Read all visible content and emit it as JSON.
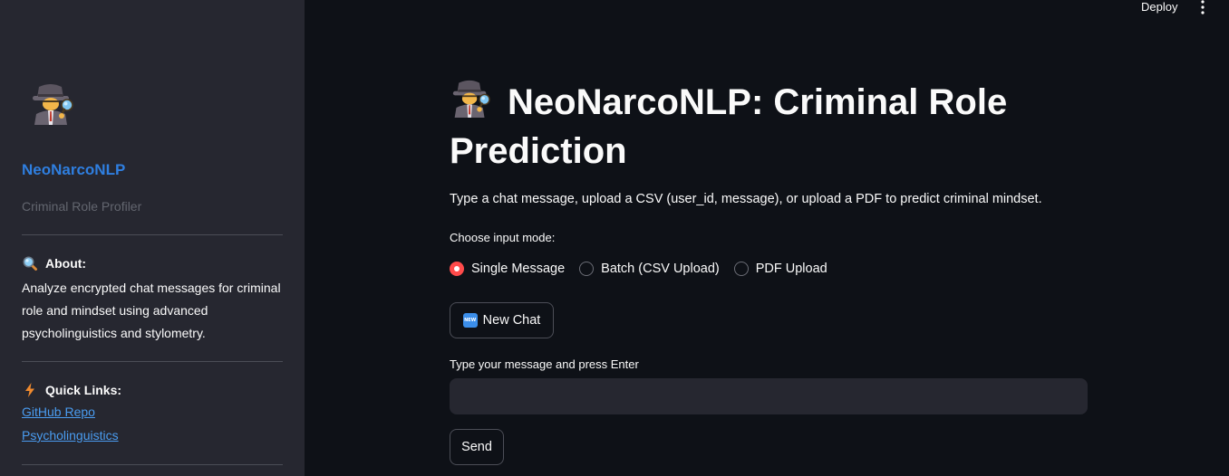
{
  "header": {
    "deploy_label": "Deploy",
    "menu_icon": "kebab-menu-icon"
  },
  "sidebar": {
    "logo_icon": "detective-icon",
    "brand": "NeoNarcoNLP",
    "subtitle": "Criminal Role Profiler",
    "about": {
      "icon": "magnifying-glass-icon",
      "title": "About:",
      "text": "Analyze encrypted chat messages for criminal role and mindset using advanced psycholinguistics and stylometry."
    },
    "quick_links": {
      "icon": "lightning-icon",
      "title": "Quick Links:",
      "links": [
        "GitHub Repo",
        "Psycholinguistics"
      ]
    }
  },
  "main": {
    "title_icon": "detective-icon",
    "title": "NeoNarcoNLP: Criminal Role Prediction",
    "intro": "Type a chat message, upload a CSV (user_id, message), or upload a PDF to predict criminal mindset.",
    "mode_label": "Choose input mode:",
    "modes": [
      "Single Message",
      "Batch (CSV Upload)",
      "PDF Upload"
    ],
    "selected_mode": "Single Message",
    "new_chat": {
      "icon": "new-badge-icon",
      "badge_text": "NEW",
      "label": "New Chat"
    },
    "input_label": "Type your message and press Enter",
    "input_value": "",
    "send_label": "Send"
  },
  "colors": {
    "sidebar_bg": "#262730",
    "main_bg": "#0e1117",
    "brand": "#2f7fe0",
    "link": "#4a9cf0",
    "radio_selected": "#ff4b4b",
    "input_bg": "#262730"
  }
}
